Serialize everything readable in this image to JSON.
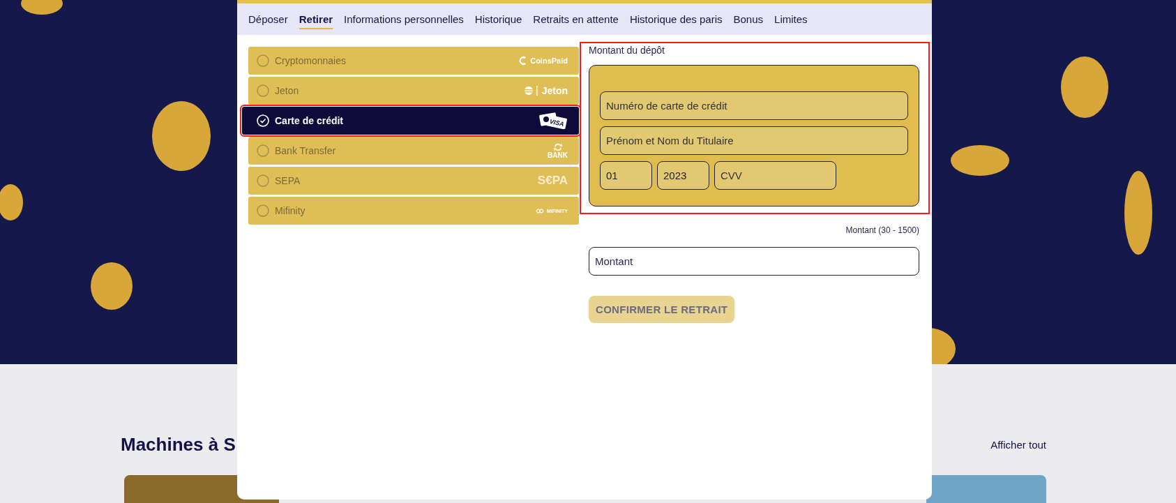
{
  "background": {
    "section_title": "Machines à S",
    "view_all_link": "Afficher tout"
  },
  "tabs": [
    {
      "label": "Déposer",
      "selected": false
    },
    {
      "label": "Retirer",
      "selected": true
    },
    {
      "label": "Informations personnelles",
      "selected": false
    },
    {
      "label": "Historique",
      "selected": false
    },
    {
      "label": "Retraits en attente",
      "selected": false
    },
    {
      "label": "Historique des paris",
      "selected": false
    },
    {
      "label": "Bonus",
      "selected": false
    },
    {
      "label": "Limites",
      "selected": false
    }
  ],
  "payment_methods": [
    {
      "name": "Cryptomonnaies",
      "selected": false,
      "kind": "coinspaid",
      "logo_text": "CoinsPaid"
    },
    {
      "name": "Jeton",
      "selected": false,
      "kind": "jeton",
      "logo_text": "Jeton"
    },
    {
      "name": "Carte de crédit",
      "selected": true,
      "kind": "card",
      "logo_text": "VISA"
    },
    {
      "name": "Bank Transfer",
      "selected": false,
      "kind": "bank",
      "logo_text": "BANK"
    },
    {
      "name": "SEPA",
      "selected": false,
      "kind": "sepa",
      "logo_text": "S€PA"
    },
    {
      "name": "Mifinity",
      "selected": false,
      "kind": "mifinity",
      "logo_text": "MIFINITY"
    }
  ],
  "card_form": {
    "label": "Montant du dépôt",
    "card_number": {
      "placeholder": "Numéro de carte de crédit"
    },
    "holder_name": {
      "placeholder": "Prénom et Nom du Titulaire"
    },
    "expiry_month": {
      "value": "01"
    },
    "expiry_year": {
      "value": "2023"
    },
    "cvv": {
      "placeholder": "CVV"
    }
  },
  "amount": {
    "hint": "Montant (30 - 1500)",
    "placeholder": "Montant"
  },
  "confirm_button": {
    "label": "CONFIRMER LE RETRAIT",
    "disabled": true
  }
}
